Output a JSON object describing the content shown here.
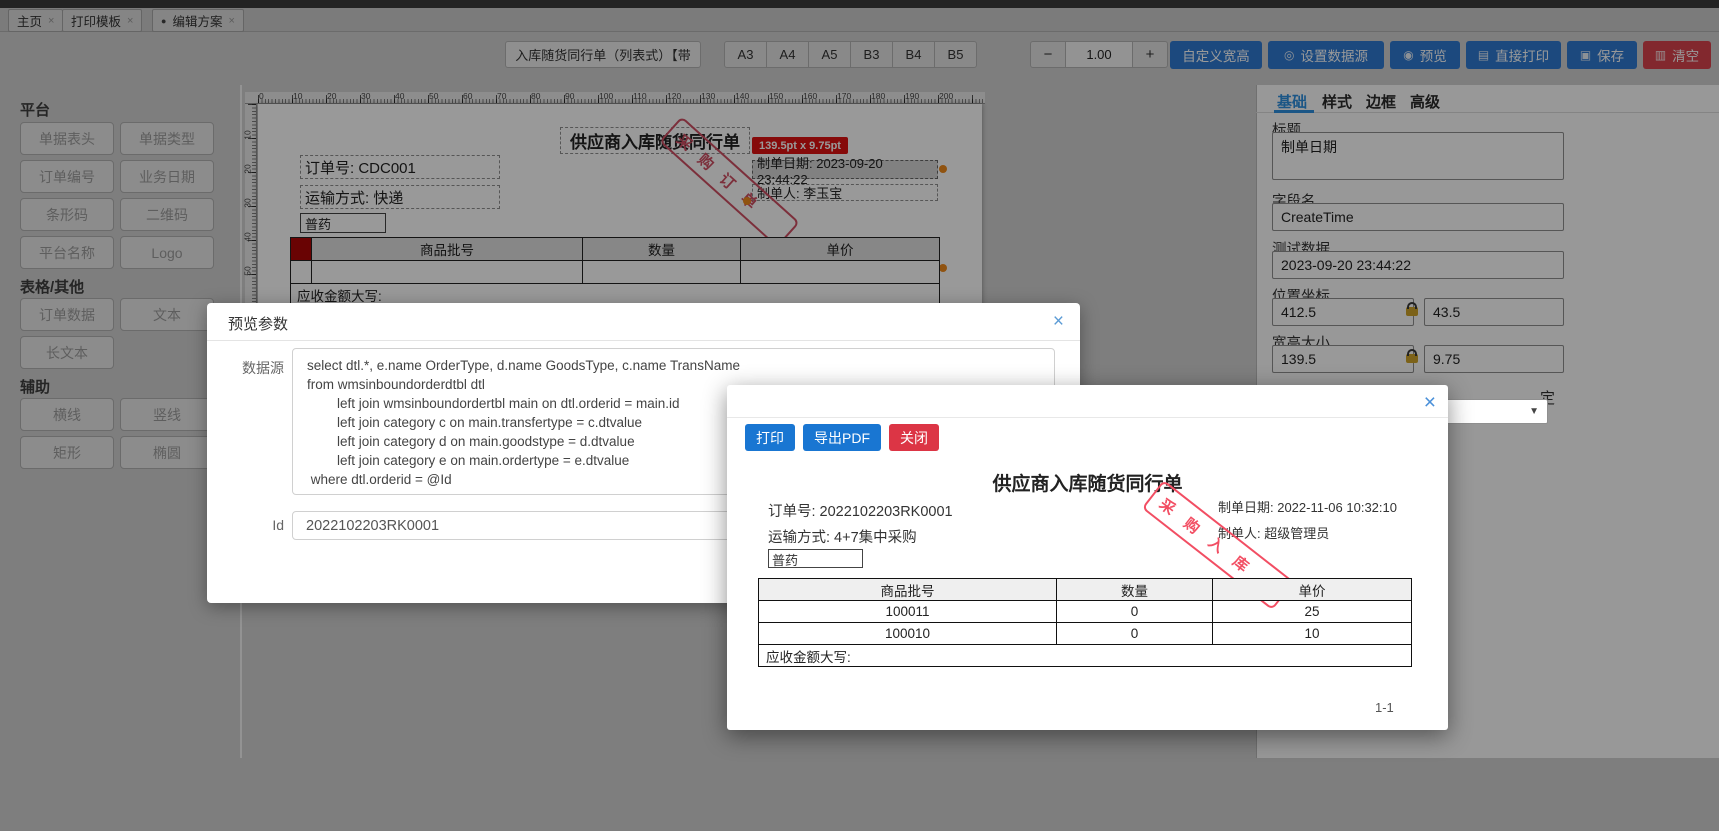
{
  "tabs": {
    "items": [
      {
        "label": "主页"
      },
      {
        "label": "打印模板"
      },
      {
        "label": "编辑方案",
        "active": true
      }
    ],
    "close_glyph": "×",
    "active_dot": "●"
  },
  "toolbar": {
    "template_name": "入库随货同行单（列表式）【带",
    "paper_sizes": [
      "A3",
      "A4",
      "A5",
      "B3",
      "B4",
      "B5"
    ],
    "zoom": {
      "minus": "−",
      "value": "1.00",
      "plus": "+"
    },
    "buttons": [
      {
        "label": "自定义宽高"
      },
      {
        "label": "设置数据源",
        "icon": "◎"
      },
      {
        "label": "预览",
        "icon": "◉"
      },
      {
        "label": "直接打印",
        "icon": "▤"
      },
      {
        "label": "保存",
        "icon": "▣"
      },
      {
        "label": "清空",
        "icon": "▥",
        "danger": true
      }
    ],
    "accent_blue": "#2f7ad3",
    "accent_red": "#d9434e"
  },
  "sidebar": {
    "sections": [
      {
        "title": "平台",
        "items": [
          "单据表头",
          "单据类型",
          "订单编号",
          "业务日期",
          "条形码",
          "二维码",
          "平台名称",
          "Logo"
        ]
      },
      {
        "title": "表格/其他",
        "items": [
          "订单数据",
          "文本",
          "长文本"
        ]
      },
      {
        "title": "辅助",
        "items": [
          "横线",
          "竖线",
          "矩形",
          "椭圆"
        ]
      }
    ]
  },
  "canvas": {
    "ruler_h": [
      "0",
      "10",
      "20",
      "30",
      "40",
      "50",
      "60",
      "70",
      "80",
      "90",
      "100",
      "110",
      "120",
      "130",
      "140",
      "150",
      "160",
      "170",
      "180",
      "190",
      "200"
    ],
    "ruler_v": [
      "10",
      "20",
      "30",
      "40",
      "50"
    ],
    "doc": {
      "title": "供应商入库随货同行单",
      "order_no": "订单号: CDC001",
      "transport": "运输方式: 快递",
      "goods_type": "普药",
      "tooltip": "139.5pt x 9.75pt",
      "create_date": "制单日期: 2023-09-20 23:44:22",
      "creator": "制单人: 李玉宝",
      "stamp": "采购订单",
      "table": {
        "headers": [
          "商品批号",
          "数量",
          "单价"
        ],
        "footer": "应收金额大写:"
      }
    }
  },
  "panel": {
    "tabs": [
      "基础",
      "样式",
      "边框",
      "高级"
    ],
    "active_tab": "基础",
    "title_label": "标题",
    "title_value": "制单日期",
    "field_label": "字段名",
    "field_value": "CreateTime",
    "test_label": "测试数据",
    "test_value": "2023-09-20 23:44:22",
    "pos_label": "位置坐标",
    "pos_x": "412.5",
    "pos_y": "43.5",
    "size_label": "宽高大小",
    "size_w": "139.5",
    "size_h": "9.75",
    "partial_label": "定",
    "select_chevron": "▼"
  },
  "modal_params": {
    "title": "预览参数",
    "close_glyph": "×",
    "datasource_label": "数据源",
    "sql": "select dtl.*, e.name OrderType, d.name GoodsType, c.name TransName\nfrom wmsinboundorderdtbl dtl\n        left join wmsinboundordertbl main on dtl.orderid = main.id\n        left join category c on main.transfertype = c.dtvalue\n        left join category d on main.goodstype = d.dtvalue\n        left join category e on main.ordertype = e.dtvalue\n where dtl.orderid = @Id",
    "id_label": "Id",
    "id_value": "2022102203RK0001"
  },
  "modal_preview": {
    "close_glyph": "×",
    "buttons": [
      {
        "label": "打印"
      },
      {
        "label": "导出PDF"
      },
      {
        "label": "关闭",
        "danger": true
      }
    ],
    "doc": {
      "title": "供应商入库随货同行单",
      "order_no": "订单号: 2022102203RK0001",
      "create_date": "制单日期: 2022-11-06 10:32:10",
      "transport": "运输方式: 4+7集中采购",
      "creator": "制单人: 超级管理员",
      "goods_type": "普药",
      "stamp": "采购入库",
      "table": {
        "headers": [
          "商品批号",
          "数量",
          "单价"
        ],
        "rows": [
          [
            "100011",
            "0",
            "25"
          ],
          [
            "100010",
            "0",
            "10"
          ]
        ],
        "footer": "应收金额大写:"
      },
      "page": "1-1"
    }
  }
}
